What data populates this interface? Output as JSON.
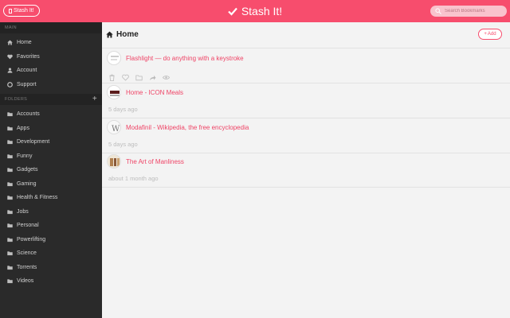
{
  "topbar": {
    "stash_button_label": "Stash It!",
    "brand": "Stash It!",
    "search_placeholder": "Search Bookmarks"
  },
  "sidebar": {
    "main_heading": "MAIN",
    "main_items": [
      {
        "label": "Home",
        "icon": "home-icon"
      },
      {
        "label": "Favorites",
        "icon": "heart-icon"
      },
      {
        "label": "Account",
        "icon": "user-icon"
      },
      {
        "label": "Support",
        "icon": "lifebuoy-icon"
      }
    ],
    "folders_heading": "FOLDERS",
    "add_folder_symbol": "+",
    "folders": [
      "Accounts",
      "Apps",
      "Development",
      "Funny",
      "Gadgets",
      "Gaming",
      "Health & Fitness",
      "Jobs",
      "Personal",
      "Powerlifting",
      "Science",
      "Torrents",
      "Videos"
    ]
  },
  "main": {
    "title": "Home",
    "add_button_label": "Add",
    "bookmarks": [
      {
        "title": "Flashlight — do anything with a keystroke",
        "time": ""
      },
      {
        "title": "Home - ICON Meals",
        "time": "5 days ago"
      },
      {
        "title": "Modafinil - Wikipedia, the free encyclopedia",
        "time": "5 days ago"
      },
      {
        "title": "The Art of Manliness",
        "time": "about 1 month ago"
      }
    ]
  },
  "colors": {
    "accent": "#f74d6d",
    "sidebar_bg": "#2a2a2a",
    "link": "#ef4466"
  }
}
